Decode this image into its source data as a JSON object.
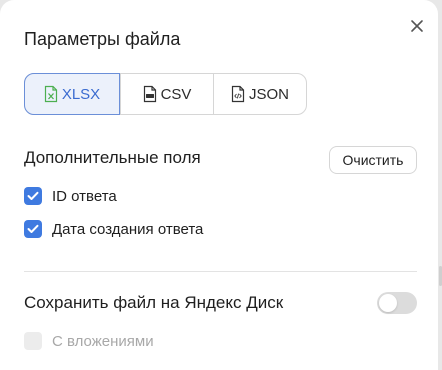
{
  "dialog": {
    "title": "Параметры файла",
    "close_icon": "close-icon"
  },
  "formats": {
    "selected": "XLSX",
    "items": [
      {
        "label": "XLSX",
        "icon": "xlsx-file-icon"
      },
      {
        "label": "CSV",
        "icon": "csv-file-icon"
      },
      {
        "label": "JSON",
        "icon": "json-file-icon"
      }
    ]
  },
  "fields": {
    "title": "Дополнительные поля",
    "clear_label": "Очистить",
    "options": [
      {
        "label": "ID ответа",
        "checked": true
      },
      {
        "label": "Дата создания ответа",
        "checked": true
      }
    ]
  },
  "disk": {
    "title": "Сохранить файл на Яндекс Диск",
    "enabled": false,
    "attachments_label": "С вложениями",
    "attachments_checked": false,
    "attachments_disabled": true
  },
  "colors": {
    "accent": "#3f7ae0",
    "selected_bg": "#ecf1fb",
    "xlsx_icon": "#4caf50"
  }
}
